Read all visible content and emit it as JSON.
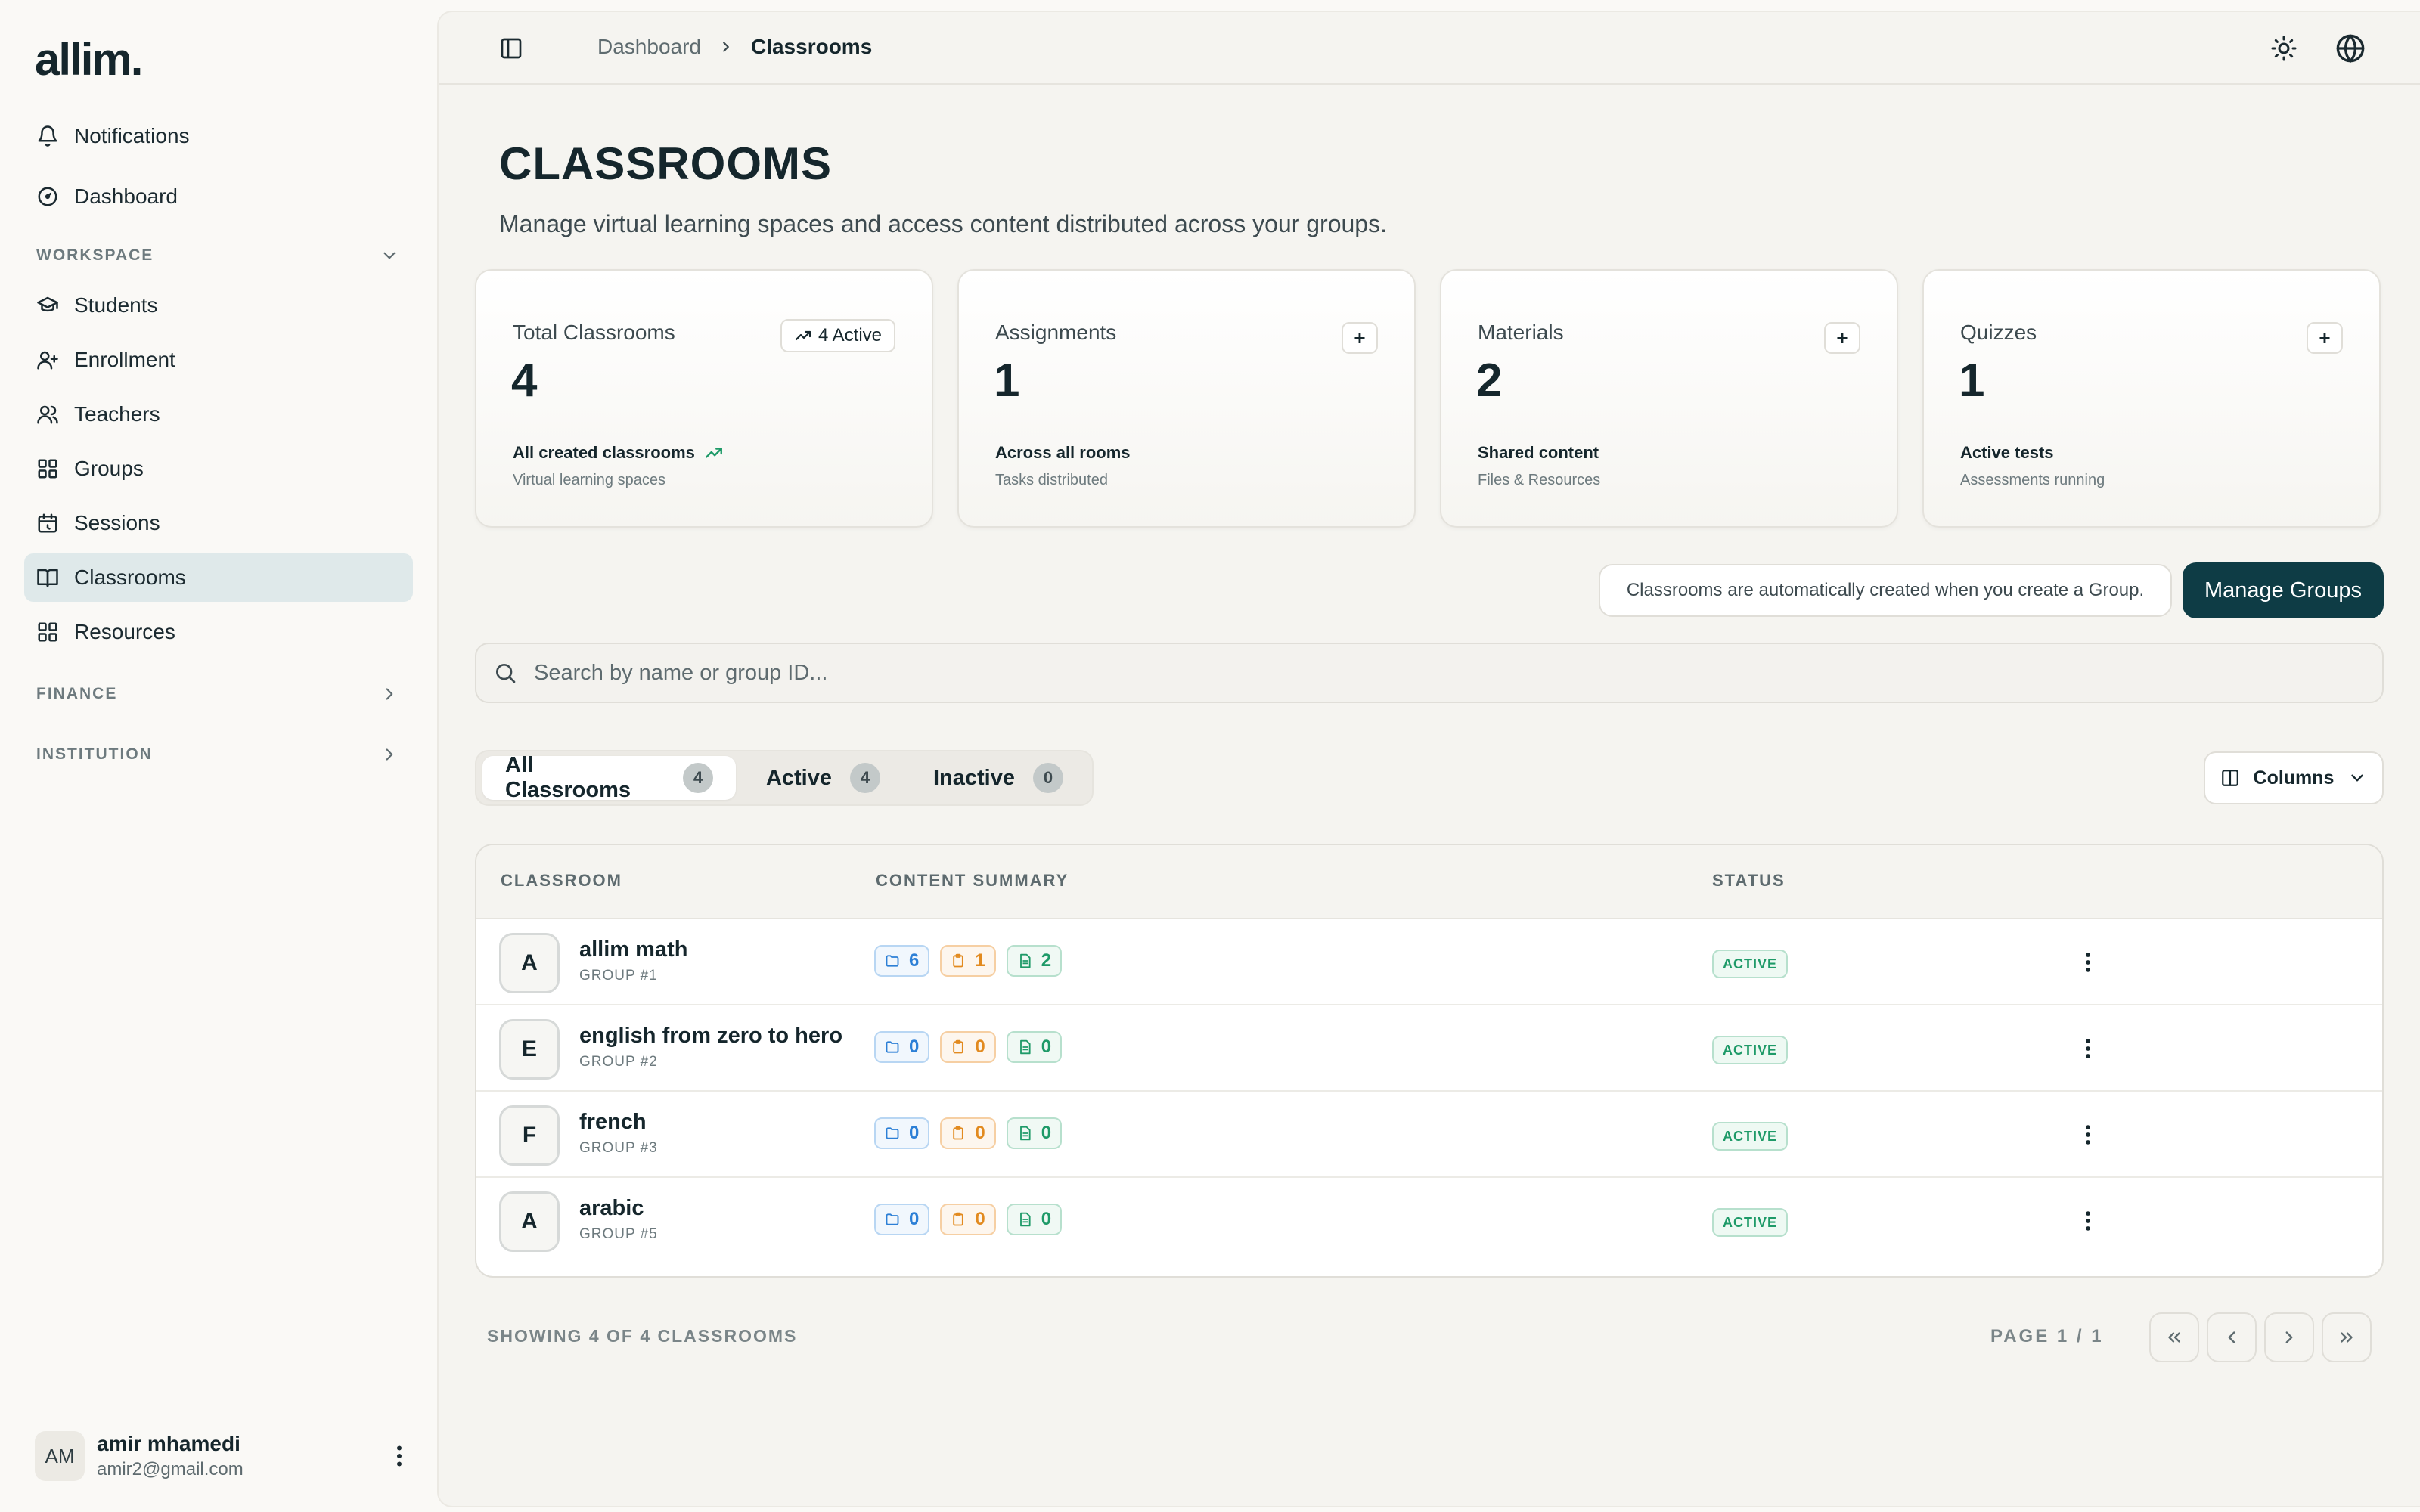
{
  "app": {
    "logo": "allim."
  },
  "sidebar": {
    "top_items": [
      {
        "label": "Notifications",
        "icon": "bell-icon"
      },
      {
        "label": "Dashboard",
        "icon": "gauge-icon"
      }
    ],
    "workspace": {
      "title": "WORKSPACE",
      "items": [
        {
          "label": "Students",
          "icon": "graduation-cap-icon"
        },
        {
          "label": "Enrollment",
          "icon": "user-plus-icon"
        },
        {
          "label": "Teachers",
          "icon": "users-icon"
        },
        {
          "label": "Groups",
          "icon": "grid-icon"
        },
        {
          "label": "Sessions",
          "icon": "calendar-icon"
        },
        {
          "label": "Classrooms",
          "icon": "book-open-icon",
          "active": true
        },
        {
          "label": "Resources",
          "icon": "grid-icon"
        }
      ]
    },
    "finance": {
      "title": "FINANCE"
    },
    "institution": {
      "title": "INSTITUTION"
    },
    "user": {
      "initials": "AM",
      "name": "amir mhamedi",
      "email": "amir2@gmail.com"
    }
  },
  "topbar": {
    "breadcrumb": {
      "home": "Dashboard",
      "current": "Classrooms"
    },
    "icons": [
      "sidebar-toggle-icon",
      "sun-icon",
      "globe-icon"
    ]
  },
  "page": {
    "title": "CLASSROOMS",
    "subtitle": "Manage virtual learning spaces and access content distributed across your groups."
  },
  "stats": {
    "total": {
      "label": "Total Classrooms",
      "value": "4",
      "badge": "4 Active",
      "foot": "All created classrooms",
      "sub": "Virtual learning spaces"
    },
    "assignments": {
      "label": "Assignments",
      "value": "1",
      "plus": "+",
      "foot": "Across all rooms",
      "sub": "Tasks distributed"
    },
    "materials": {
      "label": "Materials",
      "value": "2",
      "plus": "+",
      "foot": "Shared content",
      "sub": "Files & Resources"
    },
    "quizzes": {
      "label": "Quizzes",
      "value": "1",
      "plus": "+",
      "foot": "Active tests",
      "sub": "Assessments running"
    }
  },
  "info": {
    "text": "Classrooms are automatically created when you create a Group.",
    "manage_button": "Manage Groups"
  },
  "search": {
    "placeholder": "Search by name or group ID...",
    "value": ""
  },
  "tabs": [
    {
      "label": "All Classrooms",
      "count": "4",
      "active": true
    },
    {
      "label": "Active",
      "count": "4"
    },
    {
      "label": "Inactive",
      "count": "0"
    }
  ],
  "columns_button": "Columns",
  "table": {
    "headers": {
      "classroom": "CLASSROOM",
      "content": "CONTENT SUMMARY",
      "status": "STATUS"
    },
    "rows": [
      {
        "initial": "A",
        "name": "allim math",
        "group": "GROUP  #1",
        "materials": "6",
        "assignments": "1",
        "quizzes": "2",
        "status": "ACTIVE"
      },
      {
        "initial": "E",
        "name": "english from zero to hero",
        "group": "GROUP  #2",
        "materials": "0",
        "assignments": "0",
        "quizzes": "0",
        "status": "ACTIVE"
      },
      {
        "initial": "F",
        "name": "french",
        "group": "GROUP  #3",
        "materials": "0",
        "assignments": "0",
        "quizzes": "0",
        "status": "ACTIVE"
      },
      {
        "initial": "A",
        "name": "arabic",
        "group": "GROUP  #5",
        "materials": "0",
        "assignments": "0",
        "quizzes": "0",
        "status": "ACTIVE"
      }
    ]
  },
  "footer": {
    "showing": "SHOWING 4 OF 4 CLASSROOMS",
    "page": "PAGE 1 / 1"
  },
  "colors": {
    "accent": "#0e3c45",
    "active_nav": "#dfe9ea",
    "status_green": "#1e9a68",
    "chip_blue": "#2c7fd6",
    "chip_orange": "#e28a1f"
  }
}
